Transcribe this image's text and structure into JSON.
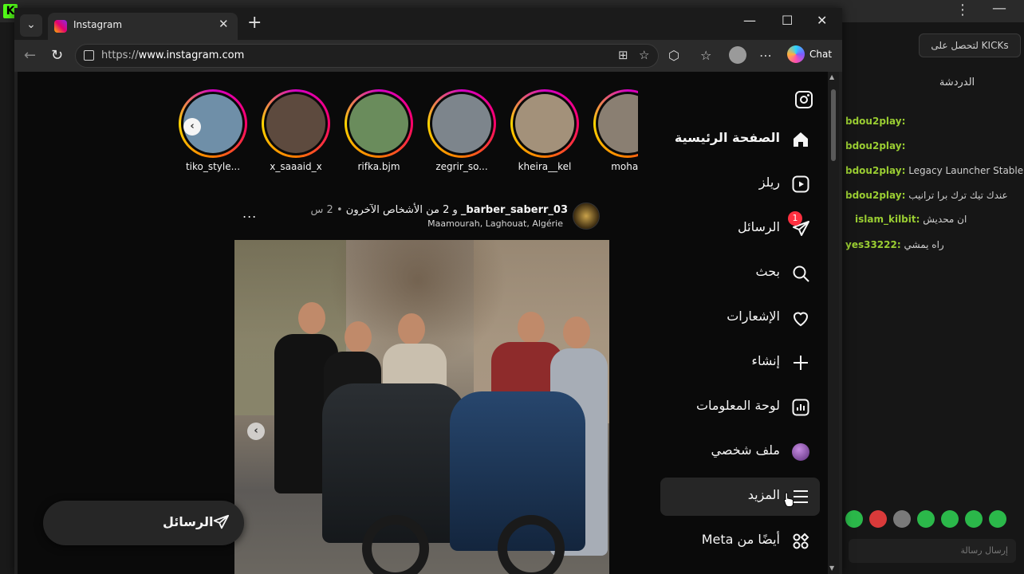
{
  "desktop": {
    "kick_logo": "K",
    "menu_dots": "⋮",
    "minimize": "—"
  },
  "chat": {
    "cta_label": "لتحصل على KICKs",
    "title": "الدردشة",
    "lines": [
      {
        "user": "bdou2play:",
        "text": ""
      },
      {
        "user": "bdou2play:",
        "text": ""
      },
      {
        "user": "bdou2play:",
        "text": " Legacy Launcher Stable"
      },
      {
        "user": "bdou2play:",
        "text": " عندك تيك ترك برا ترانيب"
      },
      {
        "user": "islam_kilbit:",
        "text": " ان محديش"
      },
      {
        "user": "yes33222:",
        "text": " راه يمشي"
      }
    ],
    "input_placeholder": "إرسال رسالة"
  },
  "browser": {
    "tab_title": "Instagram",
    "url_prefix": "https://",
    "url_host": "www.instagram.com",
    "copilot_label": "Chat"
  },
  "instagram": {
    "stories": [
      {
        "name": "tiko_style...",
        "color": "#6f8fa8"
      },
      {
        "name": "x_saaaid_x",
        "color": "#5d4a3e"
      },
      {
        "name": "rifka.bjm",
        "color": "#6a8c5c"
      },
      {
        "name": "zegrir_so...",
        "color": "#7d858c"
      },
      {
        "name": "kheira__kel",
        "color": "#a3917a"
      },
      {
        "name": "mohan",
        "color": "#8a7f72"
      }
    ],
    "post": {
      "author": "barber_saberr_03_",
      "others": "و 2 من الأشخاص الآخرون",
      "time": "• 2 س",
      "location": "Maamourah, Laghouat, Algérie",
      "more": "..."
    },
    "messages_pill_label": "الرسائل",
    "nav": [
      {
        "id": "home",
        "label": "الصفحة الرئيسية",
        "icon": "home-icon",
        "bold": true
      },
      {
        "id": "reels",
        "label": "ريلز",
        "icon": "reels-icon"
      },
      {
        "id": "messages",
        "label": "الرسائل",
        "icon": "direct-icon",
        "badge": "1"
      },
      {
        "id": "search",
        "label": "بحث",
        "icon": "search-icon"
      },
      {
        "id": "notifications",
        "label": "الإشعارات",
        "icon": "heart-icon"
      },
      {
        "id": "create",
        "label": "إنشاء",
        "icon": "plus-icon"
      },
      {
        "id": "dashboard",
        "label": "لوحة المعلومات",
        "icon": "dashboard-icon"
      },
      {
        "id": "profile",
        "label": "ملف شخصي",
        "icon": "avatar"
      },
      {
        "id": "more",
        "label": "المزيد",
        "icon": "menu-icon",
        "active": true
      },
      {
        "id": "meta",
        "label": "أيضًا من Meta",
        "icon": "meta-apps-icon"
      }
    ]
  },
  "colors": {
    "badge": "#ff3040",
    "kick_green": "#53fc18",
    "page_bg": "#0a0a0a"
  }
}
